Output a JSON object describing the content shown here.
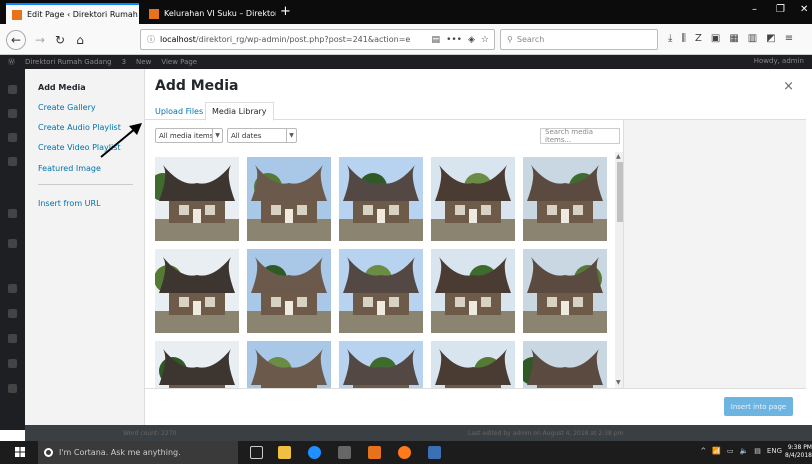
{
  "browser": {
    "tabs": [
      {
        "title": "Edit Page ‹ Direktori Rumah Ga",
        "active": true
      },
      {
        "title": "Kelurahan VI Suku – Direktori R",
        "active": false
      }
    ],
    "new_tab": "+",
    "window_controls": [
      "–",
      "❐",
      "✕"
    ],
    "url_host": "localhost",
    "url_path": "/direktori_rg/wp-admin/post.php?post=241&action=e",
    "search_placeholder": "Search"
  },
  "admin_bar": {
    "site_name": "Direktori Rumah Gadang",
    "updates": "3",
    "new_label": "New",
    "view_page": "View Page",
    "howdy": "Howdy, admin"
  },
  "modal": {
    "title": "Add Media",
    "close": "×",
    "menu": {
      "add_media": "Add Media",
      "create_gallery": "Create Gallery",
      "create_audio_playlist": "Create Audio Playlist",
      "create_video_playlist": "Create Video Playlist",
      "featured_image": "Featured Image",
      "insert_from_url": "Insert from URL"
    },
    "tabs": {
      "upload": "Upload Files",
      "library": "Media Library"
    },
    "filters": {
      "type": "All media items",
      "date": "All dates",
      "search_placeholder": "Search media items..."
    },
    "insert_button": "Insert into page"
  },
  "background": {
    "word_count": "Word count: 2270",
    "last_edited": "Last edited by admin on August 4, 2018 at 2:38 pm"
  },
  "taskbar": {
    "cortana": "I'm Cortana. Ask me anything.",
    "language": "ENG",
    "time": "9:38 PM",
    "date": "8/4/2018"
  },
  "colors": {
    "wp_link": "#0073aa",
    "insert_button": "#6eb4e0",
    "annotation_arrow": "#000000"
  }
}
